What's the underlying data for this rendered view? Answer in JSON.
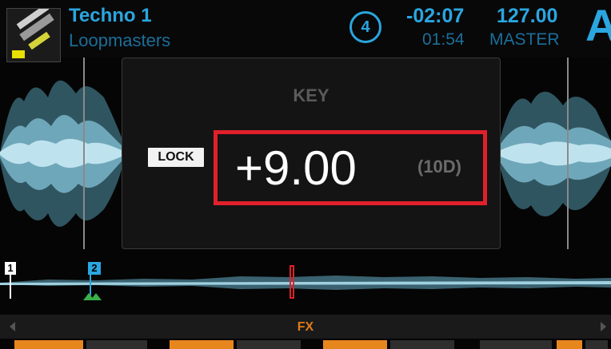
{
  "track": {
    "title": "Techno 1",
    "artist": "Loopmasters"
  },
  "deck": {
    "number": "4",
    "letter": "A"
  },
  "time": {
    "remaining": "-02:07",
    "elapsed": "01:54"
  },
  "tempo": {
    "bpm": "127.00",
    "sync_mode": "MASTER"
  },
  "key_panel": {
    "label": "KEY",
    "lock_label": "LOCK",
    "value": "+9.00",
    "code": "(10D)"
  },
  "overview": {
    "cue_points": [
      "1",
      "2"
    ]
  },
  "fx": {
    "label": "FX",
    "slots": [
      {
        "active": true
      },
      {
        "active": false
      },
      {
        "active": true
      },
      {
        "active": false
      },
      {
        "active": true
      },
      {
        "active": false
      },
      {
        "active": false
      },
      {
        "active": true
      },
      {
        "active": false
      }
    ]
  },
  "colors": {
    "accent": "#2aa6e0",
    "accent_dim": "#1c6e9a",
    "highlight": "#e0202a",
    "fx": "#e8861e",
    "waveform": "#7fb8cc"
  }
}
